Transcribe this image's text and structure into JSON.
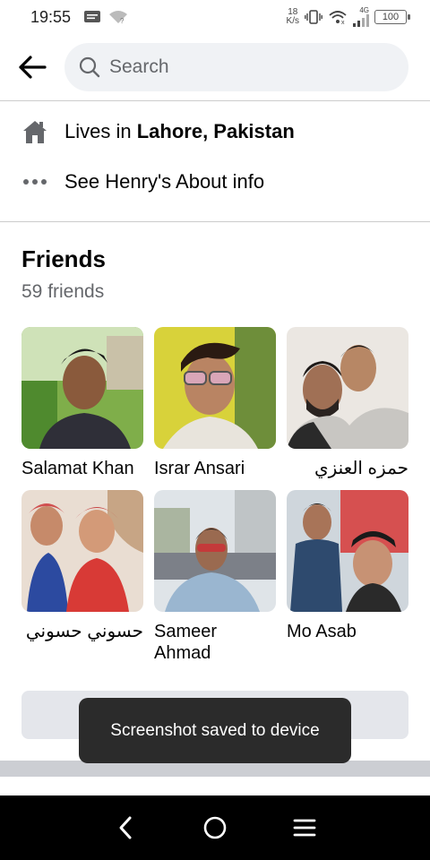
{
  "status_bar": {
    "time": "19:55",
    "net_speed_value": "18",
    "net_speed_unit": "K/s",
    "network_type": "4G",
    "battery": "100"
  },
  "header": {
    "search_placeholder": "Search"
  },
  "intro": {
    "lives_prefix": "Lives in ",
    "lives_place": "Lahore, Pakistan",
    "about_link": "See Henry's About info"
  },
  "friends": {
    "title": "Friends",
    "count": "59 friends",
    "items": [
      {
        "name": "Salamat Khan"
      },
      {
        "name": "Israr Ansari"
      },
      {
        "name": "حمزه العنزي"
      },
      {
        "name": "حسوني حسوني"
      },
      {
        "name": "Sameer Ahmad"
      },
      {
        "name": "Mo Asab"
      }
    ]
  },
  "toast": {
    "message": "Screenshot saved to device"
  },
  "colors": {
    "search_bg": "#f0f2f5",
    "secondary_text": "#65676b",
    "button_bg": "#e4e6eb",
    "toast_bg": "#2b2b2b",
    "nav_bg": "#000000"
  }
}
